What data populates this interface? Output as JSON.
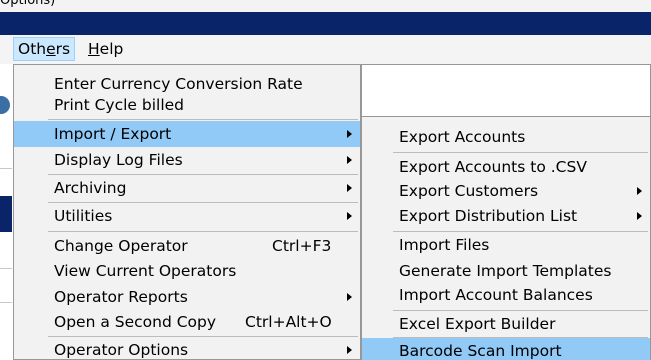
{
  "app": {
    "top_text": "Options)"
  },
  "menubar": {
    "items": [
      {
        "label_pre": "Oth",
        "label_u": "e",
        "label_post": "rs"
      },
      {
        "label_pre": "",
        "label_u": "H",
        "label_post": "elp"
      }
    ]
  },
  "others_menu": {
    "items": [
      {
        "label": "Enter Currency Conversion Rate"
      },
      {
        "label": "Print Cycle billed"
      },
      {
        "label": "Import / Export",
        "submenu": true,
        "highlighted": true
      },
      {
        "label": "Display Log Files",
        "submenu": true
      },
      {
        "label": "Archiving",
        "submenu": true
      },
      {
        "label": "Utilities",
        "submenu": true
      },
      {
        "label": "Change Operator",
        "shortcut": "Ctrl+F3"
      },
      {
        "label": "View Current Operators"
      },
      {
        "label": "Operator Reports",
        "submenu": true
      },
      {
        "label": "Open a Second Copy",
        "shortcut": "Ctrl+Alt+O"
      },
      {
        "label": "Operator Options",
        "submenu": true
      }
    ]
  },
  "import_export_menu": {
    "items": [
      {
        "label": "Export Accounts"
      },
      {
        "label": "Export Accounts to .CSV"
      },
      {
        "label": "Export Customers",
        "submenu": true
      },
      {
        "label": "Export Distribution List",
        "submenu": true
      },
      {
        "label": "Import Files"
      },
      {
        "label": "Generate Import Templates"
      },
      {
        "label": "Import Account Balances"
      },
      {
        "label": "Excel Export Builder"
      },
      {
        "label": "Barcode Scan Import",
        "highlighted": true
      }
    ]
  },
  "colors": {
    "titlebar": "#0a246a",
    "menu_background": "#f2f2f2",
    "highlight": "#91c9f7",
    "active_menu_title": "#cce8ff"
  }
}
